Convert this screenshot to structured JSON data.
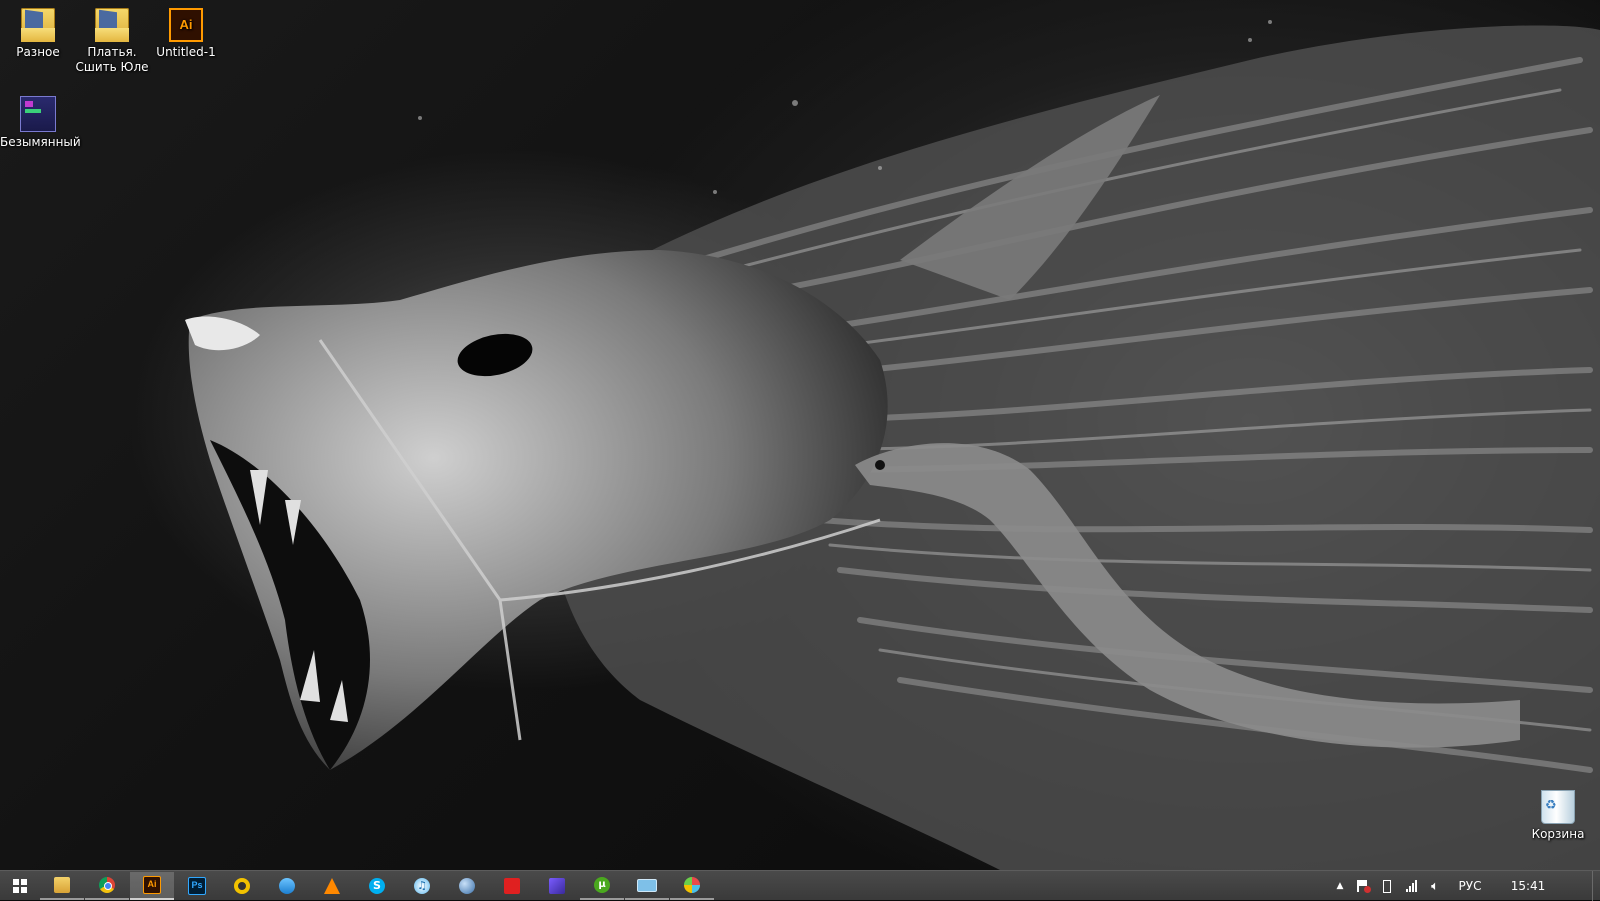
{
  "desktop": {
    "icons": [
      {
        "label": "Разное",
        "icon": "folder-icon"
      },
      {
        "label": "Платья. Сшить Юле",
        "icon": "folder-icon"
      },
      {
        "label": "Untitled-1",
        "icon": "illustrator-file-icon",
        "badge": "Ai"
      },
      {
        "label": "Безымянный",
        "icon": "app-shortcut-icon"
      },
      {
        "label": "Корзина",
        "icon": "recycle-bin-icon"
      }
    ]
  },
  "taskbar": {
    "start": {
      "icon": "windows-logo-icon"
    },
    "apps": [
      {
        "name": "file-explorer",
        "icon": "folder-icon",
        "state": "running"
      },
      {
        "name": "chrome",
        "icon": "chrome-icon",
        "state": "running"
      },
      {
        "name": "illustrator",
        "icon": "illustrator-icon",
        "label": "Ai",
        "state": "active"
      },
      {
        "name": "photoshop",
        "icon": "photoshop-icon",
        "label": "Ps",
        "state": "idle"
      },
      {
        "name": "app-yellow",
        "icon": "circle-app-icon",
        "state": "idle"
      },
      {
        "name": "app-blue-wave",
        "icon": "wave-app-icon",
        "state": "idle"
      },
      {
        "name": "vlc",
        "icon": "vlc-cone-icon",
        "state": "idle"
      },
      {
        "name": "skype",
        "icon": "skype-icon",
        "state": "idle"
      },
      {
        "name": "itunes",
        "icon": "itunes-icon",
        "state": "idle"
      },
      {
        "name": "browser-globe",
        "icon": "globe-icon",
        "state": "idle"
      },
      {
        "name": "acrobat",
        "icon": "acrobat-icon",
        "state": "idle"
      },
      {
        "name": "app-pen",
        "icon": "pen-app-icon",
        "state": "idle"
      },
      {
        "name": "utorrent",
        "icon": "utorrent-icon",
        "state": "running"
      },
      {
        "name": "on-screen-keyboard",
        "icon": "keyboard-icon",
        "state": "running"
      },
      {
        "name": "app-paint",
        "icon": "paint-icon",
        "state": "running"
      }
    ],
    "tray": {
      "language": "РУС",
      "time": "15:41"
    }
  },
  "colors": {
    "taskbar": "#3f3f3f",
    "accent_active": "#cfcfcf",
    "illustrator": "#ff9a00",
    "photoshop": "#31a8ff"
  }
}
